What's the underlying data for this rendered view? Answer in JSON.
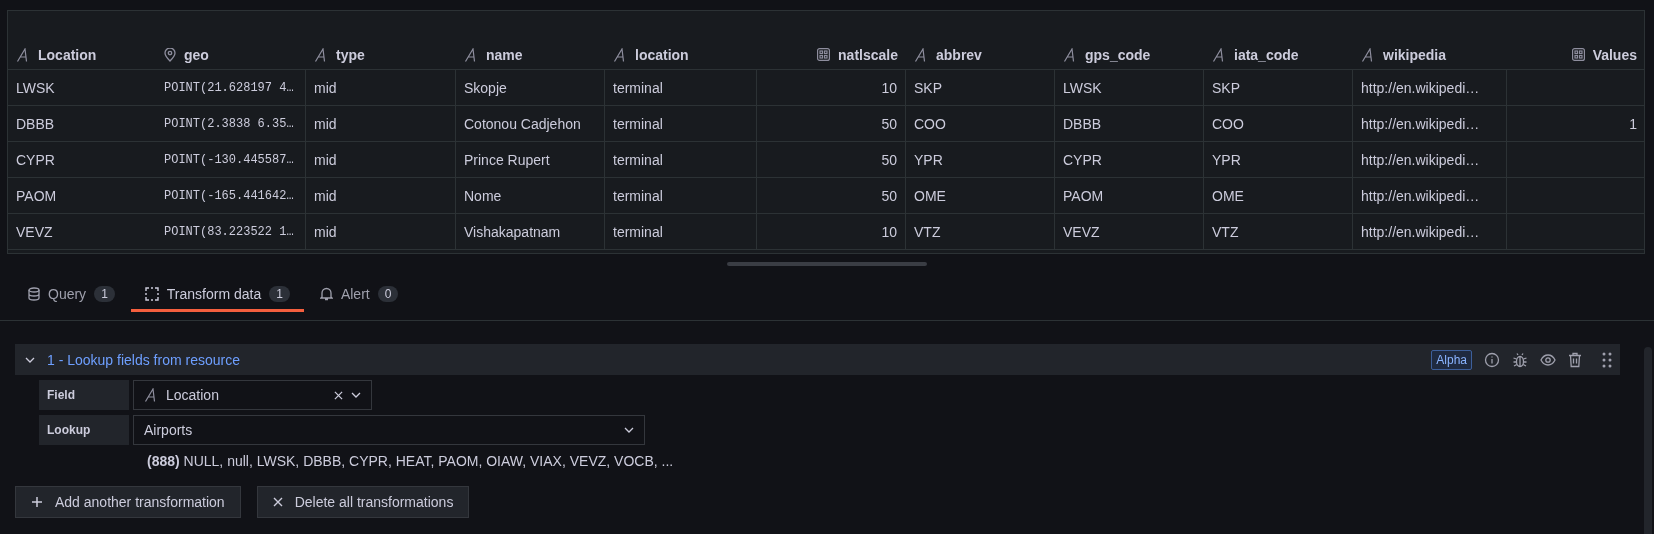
{
  "table": {
    "columns": [
      {
        "label": "Location",
        "kind": "string"
      },
      {
        "label": "geo",
        "kind": "geo"
      },
      {
        "label": "type",
        "kind": "string"
      },
      {
        "label": "name",
        "kind": "string"
      },
      {
        "label": "location",
        "kind": "string"
      },
      {
        "label": "natlscale",
        "kind": "number"
      },
      {
        "label": "abbrev",
        "kind": "string"
      },
      {
        "label": "gps_code",
        "kind": "string"
      },
      {
        "label": "iata_code",
        "kind": "string"
      },
      {
        "label": "wikipedia",
        "kind": "string"
      },
      {
        "label": "Values",
        "kind": "number"
      }
    ],
    "rows": [
      [
        "LWSK",
        "POINT(21.628197 4…",
        "mid",
        "Skopje",
        "terminal",
        "10",
        "SKP",
        "LWSK",
        "SKP",
        "http://en.wikipedi…",
        null
      ],
      [
        "DBBB",
        "POINT(2.3838 6.35…",
        "mid",
        "Cotonou Cadjehon",
        "terminal",
        "50",
        "COO",
        "DBBB",
        "COO",
        "http://en.wikipedi…",
        "1"
      ],
      [
        "CYPR",
        "POINT(-130.445587…",
        "mid",
        "Prince Rupert",
        "terminal",
        "50",
        "YPR",
        "CYPR",
        "YPR",
        "http://en.wikipedi…",
        null
      ],
      [
        "PAOM",
        "POINT(-165.441642…",
        "mid",
        "Nome",
        "terminal",
        "50",
        "OME",
        "PAOM",
        "OME",
        "http://en.wikipedi…",
        null
      ],
      [
        "VEVZ",
        "POINT(83.223522 1…",
        "mid",
        "Vishakapatnam",
        "terminal",
        "10",
        "VTZ",
        "VEVZ",
        "VTZ",
        "http://en.wikipedi…",
        null
      ]
    ]
  },
  "tabs": [
    {
      "label": "Query",
      "count": "1",
      "selected": false
    },
    {
      "label": "Transform data",
      "count": "1",
      "selected": true
    },
    {
      "label": "Alert",
      "count": "0",
      "selected": false
    }
  ],
  "transformation": {
    "title": "1 - Lookup fields from resource",
    "expanded": true,
    "badge": "Alpha",
    "field": {
      "label": "Field",
      "value": "Location"
    },
    "lookup": {
      "label": "Lookup",
      "value": "Airports"
    },
    "hint": "**(888)** NULL, null, LWSK, DBBB, CYPR, HEAT, PAOM, OIAW, VIAX, VEVZ, VOCB, ..."
  },
  "buttons": [
    {
      "label": "Add another transformation"
    },
    {
      "label": "Delete all transformations"
    }
  ]
}
